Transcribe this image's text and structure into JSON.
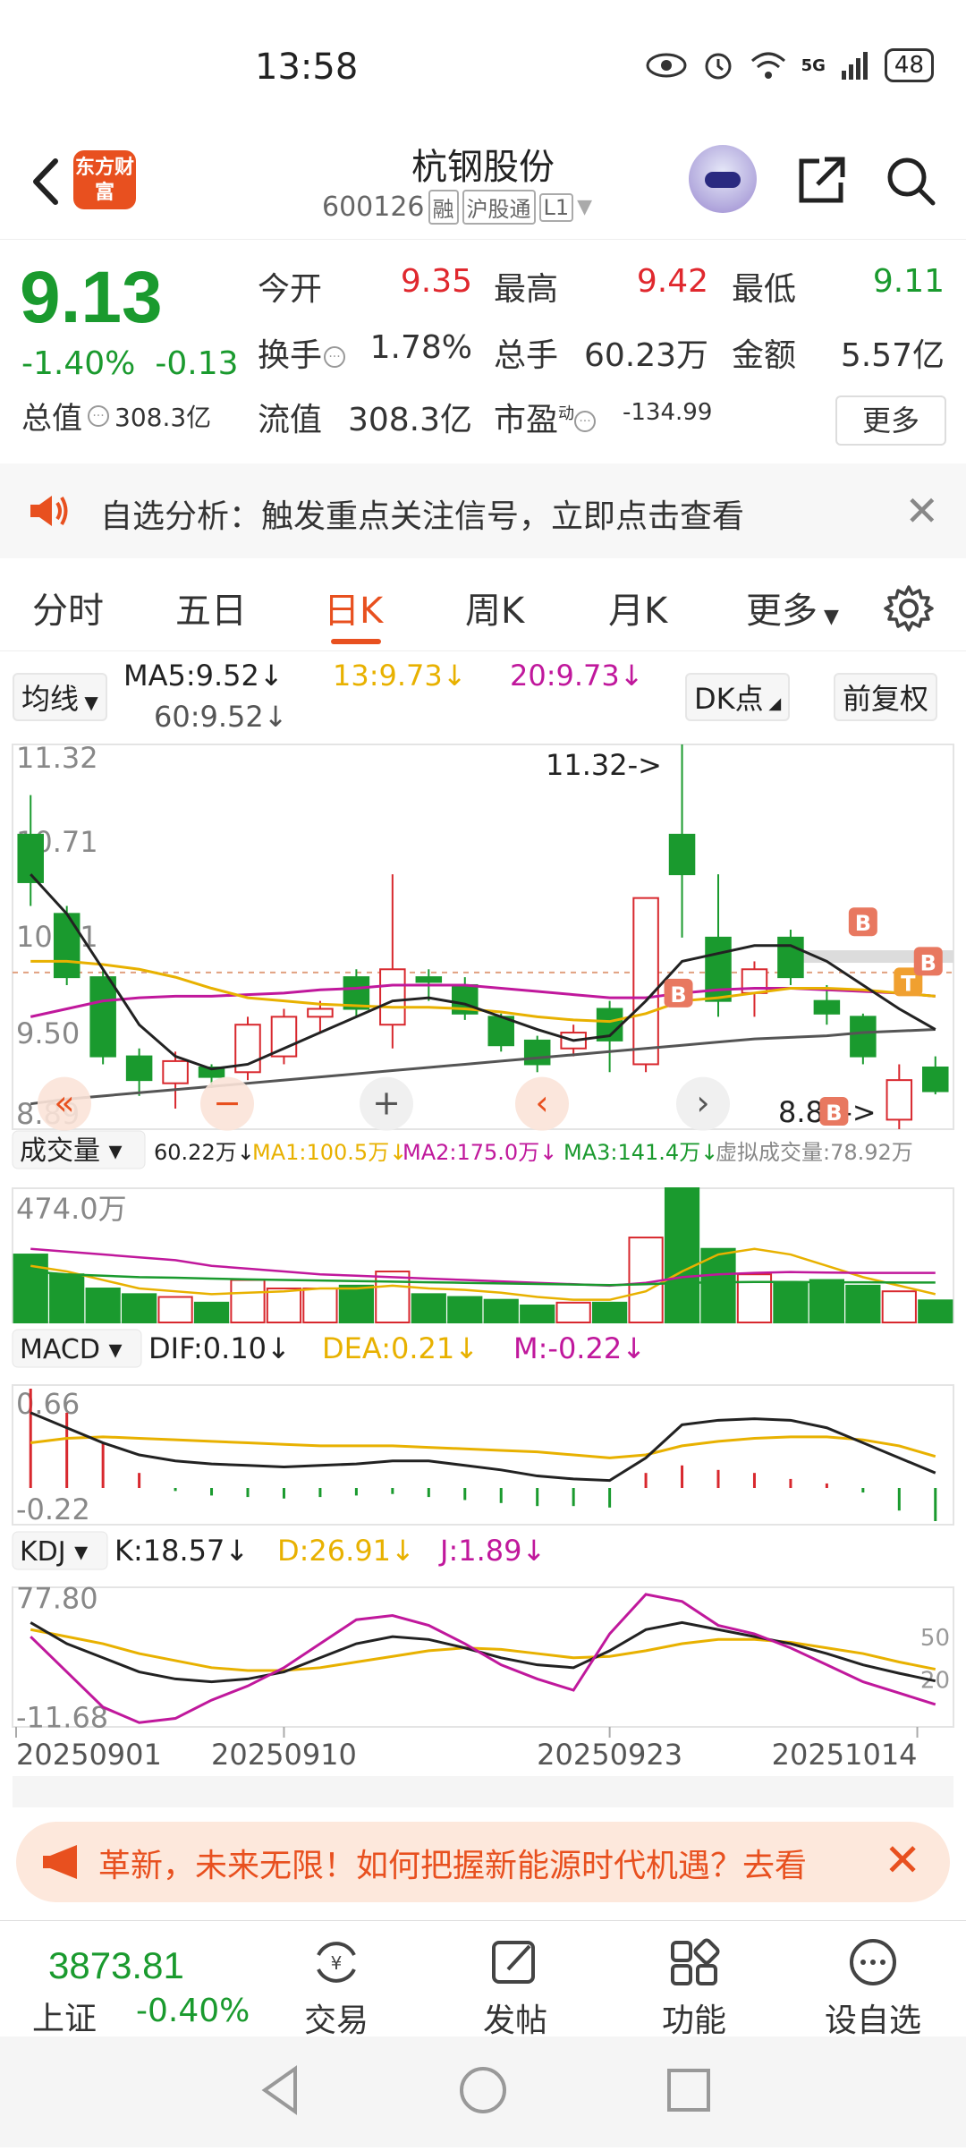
{
  "status_bar": {
    "time": "13:58",
    "network": "5G",
    "battery": "48"
  },
  "header": {
    "title": "杭钢股份",
    "code": "600126",
    "tags": [
      "融",
      "沪股通",
      "L1"
    ],
    "logo_text": "东方财富"
  },
  "quote": {
    "price": "9.13",
    "change_pct": "-1.40%",
    "change": "-0.13",
    "total_value_label": "总值",
    "total_value": "308.3亿",
    "open_label": "今开",
    "open": "9.35",
    "high_label": "最高",
    "high": "9.42",
    "low_label": "最低",
    "low": "9.11",
    "turnover_label": "换手",
    "turnover": "1.78%",
    "volume_label": "总手",
    "volume": "60.23万",
    "amount_label": "金额",
    "amount": "5.57亿",
    "float_label": "流值",
    "float_value": "308.3亿",
    "pe_label": "市盈",
    "pe_sup": "动",
    "pe": "-134.99",
    "more_label": "更多"
  },
  "notice": {
    "text": "自选分析：触发重点关注信号，立即点击查看"
  },
  "tabs": [
    "分时",
    "五日",
    "日K",
    "周K",
    "月K",
    "更多"
  ],
  "active_tab": "日K",
  "chart_header": {
    "indicator": "均线",
    "ma5": "MA5:9.52↓",
    "ma13": "13:9.73↓",
    "ma20": "20:9.73↓",
    "ma60": "60:9.52↓",
    "dk_label": "DK点",
    "adjust_label": "前复权"
  },
  "chart_data": {
    "type": "candlestick",
    "ticks": [
      "11.32",
      "10.71",
      "10.11",
      "9.50",
      "8.89"
    ],
    "marker_high": "11.32->",
    "marker_low": "8.89->",
    "x_labels": [
      "20250901",
      "20250910",
      "20250923",
      "20251014"
    ],
    "candles": [
      {
        "o": 10.75,
        "c": 10.45,
        "h": 11.0,
        "l": 10.3
      },
      {
        "o": 10.25,
        "c": 9.85,
        "h": 10.3,
        "l": 9.8
      },
      {
        "o": 9.85,
        "c": 9.35,
        "h": 9.9,
        "l": 9.3
      },
      {
        "o": 9.35,
        "c": 9.2,
        "h": 9.4,
        "l": 9.1
      },
      {
        "o": 9.18,
        "c": 9.32,
        "h": 9.38,
        "l": 9.02
      },
      {
        "o": 9.28,
        "c": 9.22,
        "h": 9.3,
        "l": 9.15
      },
      {
        "o": 9.25,
        "c": 9.55,
        "h": 9.6,
        "l": 9.2
      },
      {
        "o": 9.35,
        "c": 9.6,
        "h": 9.65,
        "l": 9.3
      },
      {
        "o": 9.6,
        "c": 9.65,
        "h": 9.7,
        "l": 9.5
      },
      {
        "o": 9.85,
        "c": 9.65,
        "h": 9.9,
        "l": 9.6
      },
      {
        "o": 9.55,
        "c": 9.9,
        "h": 10.5,
        "l": 9.4
      },
      {
        "o": 9.85,
        "c": 9.82,
        "h": 9.9,
        "l": 9.7
      },
      {
        "o": 9.8,
        "c": 9.62,
        "h": 9.85,
        "l": 9.58
      },
      {
        "o": 9.6,
        "c": 9.42,
        "h": 9.62,
        "l": 9.38
      },
      {
        "o": 9.45,
        "c": 9.3,
        "h": 9.48,
        "l": 9.25
      },
      {
        "o": 9.4,
        "c": 9.5,
        "h": 9.55,
        "l": 9.35
      },
      {
        "o": 9.65,
        "c": 9.45,
        "h": 9.7,
        "l": 9.25
      },
      {
        "o": 9.3,
        "c": 10.35,
        "h": 10.35,
        "l": 9.25
      },
      {
        "o": 10.75,
        "c": 10.5,
        "h": 11.32,
        "l": 10.1
      },
      {
        "o": 10.1,
        "c": 9.7,
        "h": 10.5,
        "l": 9.6
      },
      {
        "o": 9.75,
        "c": 9.9,
        "h": 9.95,
        "l": 9.6
      },
      {
        "o": 10.1,
        "c": 9.85,
        "h": 10.15,
        "l": 9.8
      },
      {
        "o": 9.7,
        "c": 9.62,
        "h": 9.8,
        "l": 9.55
      },
      {
        "o": 9.6,
        "c": 9.35,
        "h": 9.62,
        "l": 9.3
      },
      {
        "o": 8.95,
        "c": 9.2,
        "h": 9.3,
        "l": 8.89
      },
      {
        "o": 9.28,
        "c": 9.13,
        "h": 9.35,
        "l": 9.11
      }
    ],
    "ma5": [
      10.5,
      10.25,
      9.9,
      9.55,
      9.35,
      9.27,
      9.3,
      9.4,
      9.5,
      9.6,
      9.7,
      9.72,
      9.68,
      9.6,
      9.52,
      9.45,
      9.48,
      9.7,
      9.95,
      10.0,
      10.05,
      10.05,
      9.95,
      9.8,
      9.65,
      9.52
    ],
    "ma13": [
      9.95,
      9.95,
      9.93,
      9.9,
      9.85,
      9.78,
      9.72,
      9.7,
      9.68,
      9.67,
      9.66,
      9.66,
      9.65,
      9.63,
      9.6,
      9.58,
      9.57,
      9.62,
      9.7,
      9.72,
      9.75,
      9.78,
      9.78,
      9.77,
      9.75,
      9.73
    ],
    "ma20": [
      9.6,
      9.65,
      9.7,
      9.72,
      9.73,
      9.73,
      9.74,
      9.75,
      9.77,
      9.78,
      9.8,
      9.8,
      9.8,
      9.78,
      9.76,
      9.74,
      9.72,
      9.72,
      9.75,
      9.77,
      9.78,
      9.78,
      9.77,
      9.76,
      9.75,
      9.73
    ],
    "ma60": [
      9.05,
      9.08,
      9.1,
      9.12,
      9.14,
      9.16,
      9.18,
      9.2,
      9.22,
      9.24,
      9.26,
      9.28,
      9.3,
      9.32,
      9.34,
      9.36,
      9.38,
      9.4,
      9.42,
      9.44,
      9.46,
      9.47,
      9.48,
      9.5,
      9.51,
      9.52
    ],
    "volume": {
      "label": "成交量",
      "current": "60.22万↓",
      "ma1": "MA1:100.5万↓",
      "ma2": "MA2:175.0万↓",
      "ma3": "MA3:141.4万↓",
      "virtual": "虚拟成交量:78.92万",
      "max_label": "474.0万",
      "values": [
        240,
        170,
        120,
        100,
        90,
        70,
        150,
        120,
        120,
        130,
        180,
        100,
        90,
        80,
        60,
        70,
        70,
        300,
        474,
        260,
        170,
        140,
        150,
        130,
        110,
        78
      ]
    },
    "macd": {
      "label": "MACD",
      "dif": "DIF:0.10↓",
      "dea": "DEA:0.21↓",
      "m": "M:-0.22↓",
      "ticks": [
        "0.66",
        "-0.22"
      ],
      "dif_series": [
        0.5,
        0.4,
        0.3,
        0.22,
        0.18,
        0.16,
        0.15,
        0.14,
        0.15,
        0.16,
        0.18,
        0.18,
        0.15,
        0.12,
        0.08,
        0.06,
        0.05,
        0.2,
        0.42,
        0.45,
        0.46,
        0.45,
        0.4,
        0.3,
        0.2,
        0.1
      ],
      "dea_series": [
        0.3,
        0.33,
        0.34,
        0.33,
        0.32,
        0.31,
        0.3,
        0.29,
        0.28,
        0.28,
        0.28,
        0.27,
        0.26,
        0.25,
        0.24,
        0.22,
        0.2,
        0.22,
        0.28,
        0.31,
        0.33,
        0.34,
        0.34,
        0.32,
        0.28,
        0.21
      ],
      "m_series": [
        0.66,
        0.5,
        0.3,
        0.1,
        -0.02,
        -0.05,
        -0.06,
        -0.07,
        -0.06,
        -0.05,
        -0.04,
        -0.06,
        -0.08,
        -0.1,
        -0.12,
        -0.12,
        -0.13,
        0.1,
        0.15,
        0.12,
        0.1,
        0.06,
        0.03,
        -0.03,
        -0.15,
        -0.22
      ]
    },
    "kdj": {
      "label": "KDJ",
      "k": "K:18.57↓",
      "d": "D:26.91↓",
      "j": "J:1.89↓",
      "ticks": [
        "77.80",
        "-11.68"
      ],
      "right_ticks": [
        "50",
        "20"
      ],
      "k_series": [
        60,
        45,
        35,
        25,
        20,
        18,
        20,
        25,
        35,
        45,
        50,
        48,
        42,
        35,
        30,
        28,
        40,
        55,
        60,
        55,
        50,
        45,
        38,
        30,
        24,
        18.57
      ],
      "d_series": [
        55,
        50,
        45,
        38,
        33,
        28,
        26,
        26,
        28,
        32,
        36,
        40,
        42,
        41,
        38,
        35,
        36,
        40,
        45,
        48,
        48,
        46,
        42,
        38,
        32,
        26.91
      ],
      "j_series": [
        50,
        25,
        0,
        -11,
        -8,
        5,
        15,
        28,
        45,
        62,
        65,
        58,
        45,
        30,
        20,
        12,
        52,
        80,
        75,
        58,
        52,
        42,
        30,
        18,
        10,
        1.89
      ]
    }
  },
  "ad": {
    "text": "革新，未来无限！如何把握新能源时代机遇？去看"
  },
  "bottom_bar": {
    "index_value": "3873.81",
    "index_name": "上证",
    "index_pct": "-0.40%",
    "items": [
      "交易",
      "发帖",
      "功能",
      "设自选"
    ]
  }
}
